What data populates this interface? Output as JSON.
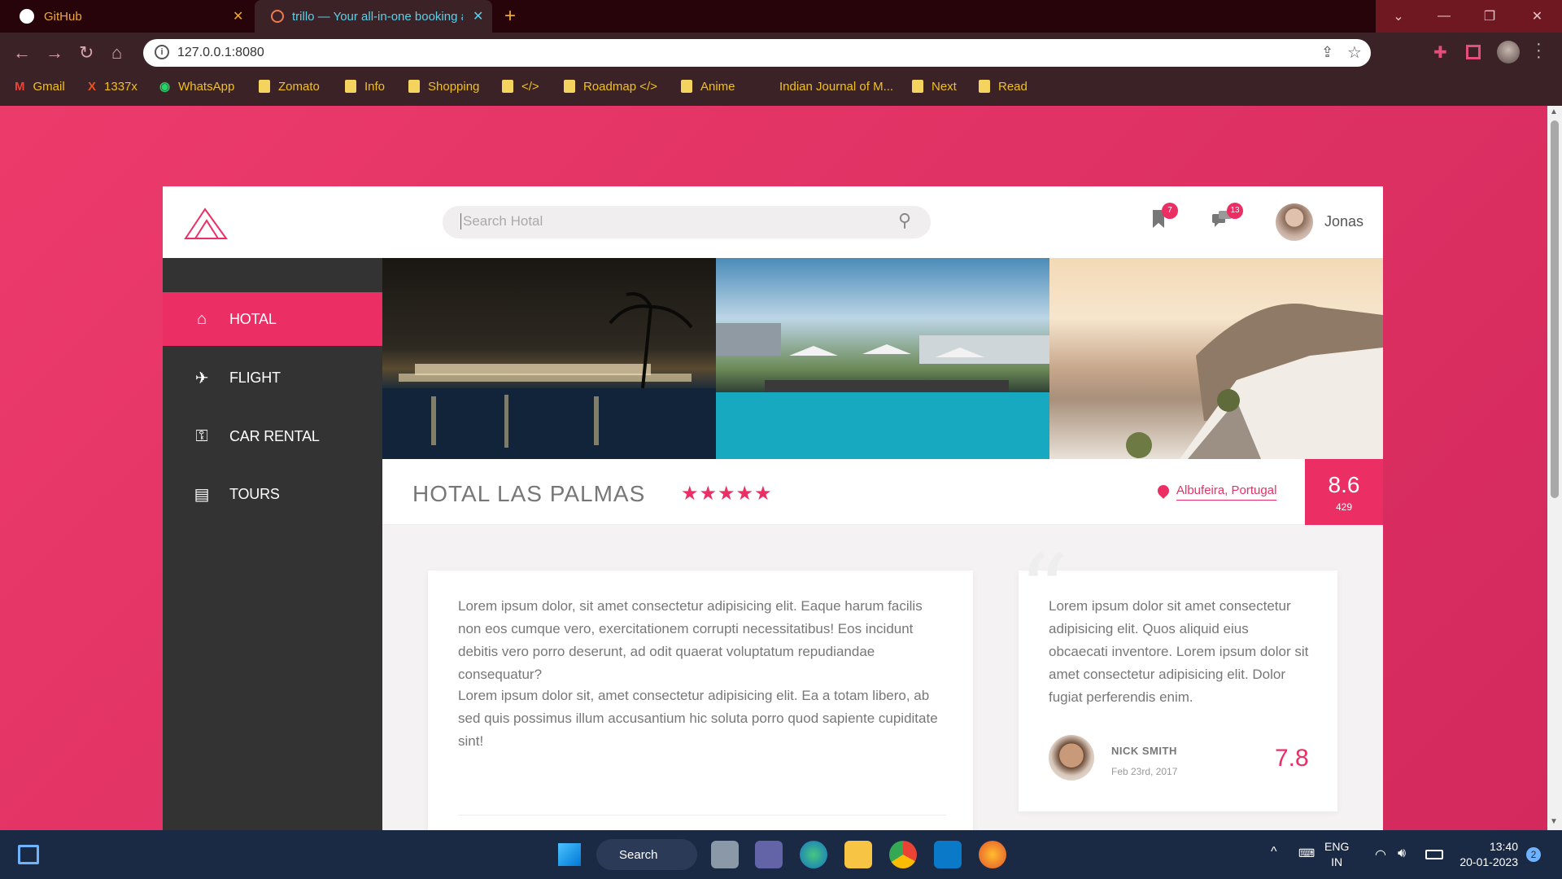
{
  "browser": {
    "tabs": [
      {
        "title": "GitHub",
        "close": "✕"
      },
      {
        "title": "trillo — Your all-in-one booking app",
        "close": "✕"
      }
    ],
    "new_tab": "+",
    "url": "127.0.0.1:8080",
    "bookmarks": [
      "Gmail",
      "1337x",
      "WhatsApp",
      "Zomato",
      "Info",
      "Shopping",
      "</>",
      "Roadmap </>",
      "Anime",
      "Indian Journal of M...",
      "Next",
      "Read"
    ]
  },
  "app": {
    "search_placeholder": "Search Hotal",
    "notifications": {
      "bookmarks": "7",
      "messages": "13"
    },
    "user": {
      "name": "Jonas"
    },
    "nav": [
      {
        "label": "HOTAL",
        "icon": "home-icon",
        "active": true
      },
      {
        "label": "FLIGHT",
        "icon": "plane-icon"
      },
      {
        "label": "CAR RENTAL",
        "icon": "key-icon"
      },
      {
        "label": "TOURS",
        "icon": "map-icon"
      }
    ],
    "hotel": {
      "title": "HOTAL LAS PALMAS",
      "stars": "★★★★★",
      "location": "Albufeira, Portugal",
      "rating_avg": "8.6",
      "rating_count": "429"
    },
    "description": [
      "Lorem ipsum dolor, sit amet consectetur adipisicing elit. Eaque harum facilis non eos cumque vero, exercitationem corrupti necessitatibus! Eos incidunt debitis vero porro deserunt, ad odit quaerat voluptatum repudiandae consequatur?",
      "Lorem ipsum dolor sit, amet consectetur adipisicing elit. Ea a totam libero, ab sed quis possimus illum accusantium hic soluta porro quod sapiente cupiditate sint!"
    ],
    "review": {
      "text": "Lorem ipsum dolor sit amet consectetur adipisicing elit. Quos aliquid eius obcaecati inventore. Lorem ipsum dolor sit amet consectetur adipisicing elit. Dolor fugiat perferendis enim.",
      "name": "NICK SMITH",
      "date": "Feb 23rd, 2017",
      "rating": "7.8"
    },
    "colors": {
      "primary": "#eb2f64",
      "sidebar": "#333333"
    }
  },
  "taskbar": {
    "search_label": "Search",
    "lang_1": "ENG",
    "lang_2": "IN",
    "time": "13:40",
    "date": "20-01-2023",
    "notif_count": "2"
  }
}
